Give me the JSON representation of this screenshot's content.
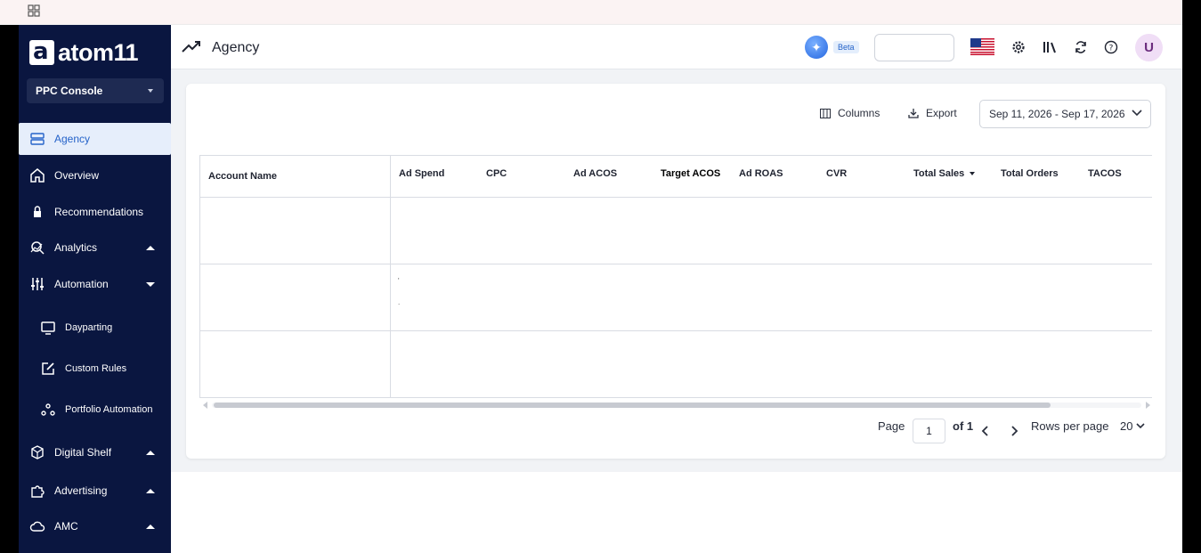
{
  "sidebar": {
    "logo_text": "atom11",
    "logo_mark": "a",
    "console_select": "PPC Console",
    "items": [
      {
        "label": "Agency",
        "icon": "server-icon",
        "active": true
      },
      {
        "label": "Overview",
        "icon": "home-icon"
      },
      {
        "label": "Recommendations",
        "icon": "lock-icon"
      },
      {
        "label": "Analytics",
        "icon": "analytics-icon",
        "expanded": false
      },
      {
        "label": "Automation",
        "icon": "sliders-icon",
        "expanded": true
      },
      {
        "label": "Dayparting",
        "icon": "monitor-icon",
        "sub": true
      },
      {
        "label": "Custom Rules",
        "icon": "edit-icon",
        "sub": true
      },
      {
        "label": "Portfolio Automation",
        "icon": "nodes-icon",
        "sub": true
      },
      {
        "label": "Digital Shelf",
        "icon": "shelf-icon",
        "expanded": false
      },
      {
        "label": "Advertising",
        "icon": "puzzle-icon",
        "expanded": false
      },
      {
        "label": "AMC",
        "icon": "cloud-icon",
        "expanded": false
      }
    ]
  },
  "header": {
    "title": "Agency",
    "beta_label": "Beta",
    "avatar_initial": "U"
  },
  "toolbar": {
    "columns_label": "Columns",
    "export_label": "Export",
    "date_range": "Sep 11, 2026 - Sep 17, 2026"
  },
  "table": {
    "columns": [
      "Account Name",
      "Ad Spend",
      "CPC",
      "Ad ACOS",
      "Target ACOS",
      "Ad ROAS",
      "CVR",
      "Total Sales",
      "Total Orders",
      "TACOS"
    ],
    "sorted_column": "Total Sales",
    "row_count": 3
  },
  "pagination": {
    "page_label": "Page",
    "page_value": "1",
    "of_label": "of 1",
    "rows_per_page_label": "Rows per page",
    "rows_per_page_value": "20"
  },
  "colors": {
    "sidebar_bg": "#0a1640",
    "active_bg": "#e6eefb",
    "accent": "#2563c9"
  }
}
